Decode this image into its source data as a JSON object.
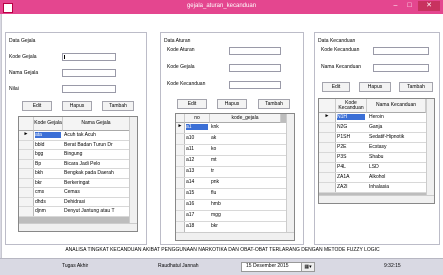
{
  "window": {
    "title": "gejala_aturan_kecanduan",
    "minimize": "–",
    "maximize": "□",
    "close": "✕"
  },
  "gejala": {
    "panel_title": "Data Gejala",
    "kode_label": "Kode Gejala",
    "nama_label": "Nama Gejala",
    "nilai_label": "Nilai",
    "kode_value": "",
    "nama_value": "",
    "nilai_value": "",
    "buttons": [
      "Edit",
      "Hapus",
      "Tambah"
    ],
    "columns": [
      "Kode Gejala",
      "Nama Gejala"
    ],
    "rows": [
      [
        "ata",
        "Acuh tak Acuh"
      ],
      [
        "bbld",
        "Berat Badan Turun Dr"
      ],
      [
        "bgg",
        "Bingung"
      ],
      [
        "Bp",
        "Bicara Jadi Pelo"
      ],
      [
        "bkh",
        "Bengkak pada Daerah"
      ],
      [
        "bkr",
        "Berkeringat"
      ],
      [
        "cms",
        "Cemas"
      ],
      [
        "dhds",
        "Dehidrasi"
      ],
      [
        "djnm",
        "Denyut Jantung atau T"
      ]
    ]
  },
  "aturan": {
    "panel_title": "Data Aturan",
    "kode_aturan_label": "Kode Aturan",
    "kode_gejala_label": "Kode Gejala",
    "kode_kecanduan_label": "Kode Kecanduan",
    "kode_aturan_value": "",
    "kode_gejala_value": "",
    "kode_kecanduan_value": "",
    "buttons": [
      "Edit",
      "Hapus",
      "Tambah"
    ],
    "columns": [
      "no",
      "kode_gejala"
    ],
    "rows": [
      [
        "a1",
        "knk"
      ],
      [
        "a10",
        "ak"
      ],
      [
        "a11",
        "ko"
      ],
      [
        "a12",
        "mt"
      ],
      [
        "a13",
        "tr"
      ],
      [
        "a14",
        "pnk"
      ],
      [
        "a15",
        "flu"
      ],
      [
        "a16",
        "hmb"
      ],
      [
        "a17",
        "mgg"
      ],
      [
        "a18",
        "bkr"
      ]
    ]
  },
  "kecanduan": {
    "panel_title": "Data Kecanduan",
    "kode_label": "Kode Kecanduan",
    "nama_label": "Nama Kecanduan",
    "kode_value": "",
    "nama_value": "",
    "buttons": [
      "Edit",
      "Hapus",
      "Tambah"
    ],
    "columns": [
      "Kode Kecanduan",
      "Nama Kecanduan"
    ],
    "rows": [
      [
        "N1H",
        "Heroin"
      ],
      [
        "N2G",
        "Ganja"
      ],
      [
        "P1SH",
        "Sedatif-Hipnotik"
      ],
      [
        "P2E",
        "Ecstasy"
      ],
      [
        "P3S",
        "Shabu"
      ],
      [
        "P4L",
        "LSD"
      ],
      [
        "ZA1A",
        "Alkohol"
      ],
      [
        "ZA2I",
        "Inhalasia"
      ]
    ]
  },
  "footer_text": "ANALISA TINGKAT KECANDUAN AKIBAT PENGGUNAAN NARKOTIKA DAN OBAT-OBAT TERLARANG DENGAN METODE FUZZY LOGIC",
  "status": {
    "tugas": "Tugas Akhir",
    "author": "Raudhatul Jannah",
    "date": "15 Desember 2015",
    "time": "9:32:15"
  },
  "colors": {
    "titlebar": "#e4468f",
    "selection": "#3b6fd6"
  }
}
